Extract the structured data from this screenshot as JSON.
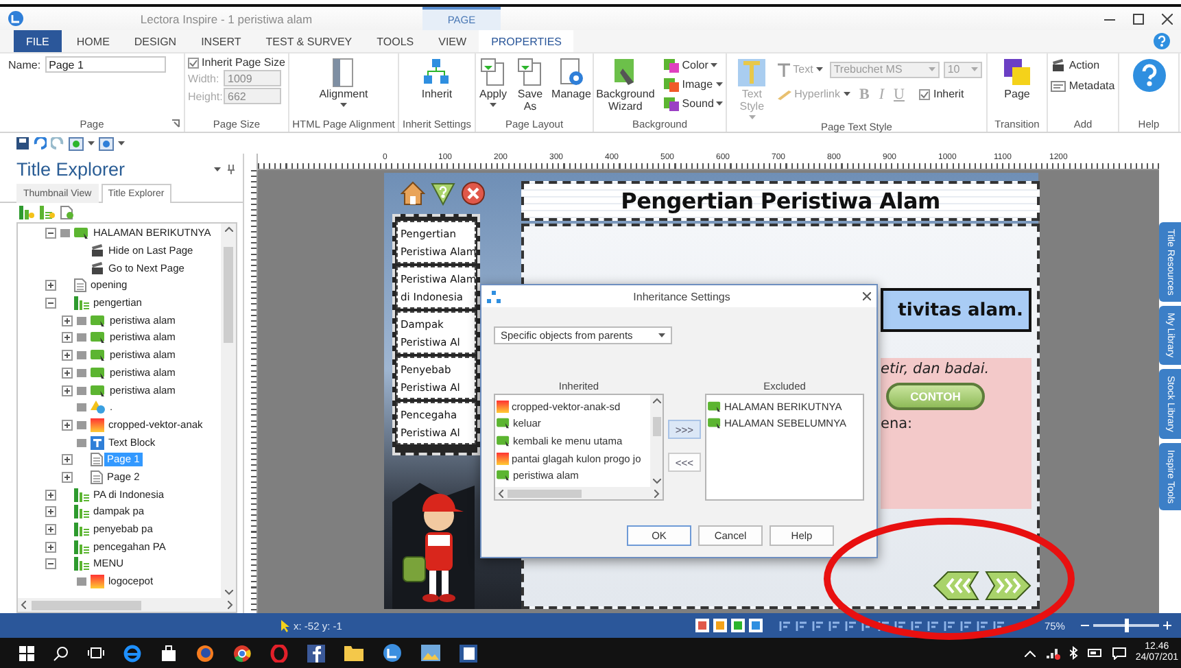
{
  "window": {
    "title": "Lectora Inspire - 1 peristiwa alam",
    "context_tab": "PAGE"
  },
  "menu_tabs": [
    {
      "label": "FILE",
      "kind": "file",
      "selected": false
    },
    {
      "label": "HOME",
      "kind": "tab",
      "selected": false
    },
    {
      "label": "DESIGN",
      "kind": "tab",
      "selected": false
    },
    {
      "label": "INSERT",
      "kind": "tab",
      "selected": false
    },
    {
      "label": "TEST & SURVEY",
      "kind": "tab",
      "selected": false
    },
    {
      "label": "TOOLS",
      "kind": "tab",
      "selected": false
    },
    {
      "label": "VIEW",
      "kind": "tab",
      "selected": false
    },
    {
      "label": "PROPERTIES",
      "kind": "tab",
      "selected": true
    }
  ],
  "ribbon": {
    "page": {
      "caption": "Page",
      "name_label": "Name:",
      "name_value": "Page 1"
    },
    "page_size": {
      "caption": "Page Size",
      "inherit_label": "Inherit Page Size",
      "inherit_checked": true,
      "width_label": "Width:",
      "width_value": "1009",
      "height_label": "Height:",
      "height_value": "662",
      "fields_disabled": true
    },
    "alignment": {
      "caption": "HTML Page Alignment",
      "button": {
        "label": "Alignment",
        "dropdown": true
      }
    },
    "inherit": {
      "caption": "Inherit Settings",
      "button": {
        "label": "Inherit",
        "dropdown": false
      }
    },
    "page_layout": {
      "caption": "Page Layout",
      "buttons": [
        {
          "label": "Apply",
          "dropdown": true
        },
        {
          "label": "Save As",
          "dropdown": false
        },
        {
          "label": "Manage",
          "dropdown": false
        }
      ]
    },
    "background": {
      "caption": "Background",
      "wizard": {
        "label": "Background Wizard",
        "dropdown": false
      },
      "buttons": [
        {
          "label": "Color",
          "dropdown": true
        },
        {
          "label": "Image",
          "dropdown": true
        },
        {
          "label": "Sound",
          "dropdown": true
        }
      ]
    },
    "text_style": {
      "caption": "Page Text Style",
      "style_button": {
        "label": "Text Style",
        "dropdown": true,
        "disabled": true
      },
      "text_button": {
        "label": "Text",
        "dropdown": true,
        "disabled": true
      },
      "font": {
        "value": "Trebuchet MS",
        "disabled": true
      },
      "size": {
        "value": "10",
        "disabled": true
      },
      "hyperlink": {
        "label": "Hyperlink",
        "dropdown": true,
        "disabled": true
      },
      "format": [
        {
          "label": "B",
          "disabled": true
        },
        {
          "label": "I",
          "disabled": true
        },
        {
          "label": "U",
          "disabled": true
        }
      ],
      "inherit": {
        "label": "Inherit",
        "checked": true
      }
    },
    "transition": {
      "caption": "Transition",
      "button": {
        "label": "Page",
        "dropdown": false
      }
    },
    "add": {
      "caption": "Add",
      "buttons": [
        {
          "label": "Action"
        },
        {
          "label": "Metadata"
        }
      ]
    },
    "help": {
      "caption": "Help"
    }
  },
  "title_explorer": {
    "title": "Title Explorer",
    "tabs": [
      {
        "label": "Thumbnail View",
        "selected": false
      },
      {
        "label": "Title Explorer",
        "selected": true
      }
    ],
    "tree": [
      {
        "label": "HALAMAN BERIKUTNYA",
        "kind": "button",
        "expanded": true,
        "selected": false,
        "children": [
          {
            "label": "Hide on Last Page",
            "kind": "action",
            "selected": false
          },
          {
            "label": "Go to Next Page",
            "kind": "action",
            "selected": false
          }
        ]
      },
      {
        "label": "opening",
        "kind": "page",
        "expanded": false,
        "selected": false
      },
      {
        "label": "pengertian",
        "kind": "chapter",
        "expanded": true,
        "selected": false,
        "children": [
          {
            "label": "peristiwa alam",
            "kind": "button",
            "expanded": false,
            "selected": false
          },
          {
            "label": "peristiwa alam",
            "kind": "button",
            "expanded": false,
            "selected": false
          },
          {
            "label": "peristiwa alam",
            "kind": "button",
            "expanded": false,
            "selected": false
          },
          {
            "label": "peristiwa alam",
            "kind": "button",
            "expanded": false,
            "selected": false
          },
          {
            "label": "peristiwa alam",
            "kind": "button",
            "expanded": false,
            "selected": false
          },
          {
            "label": ".",
            "kind": "shape",
            "selected": false
          },
          {
            "label": "cropped-vektor-anak",
            "kind": "image",
            "expanded": false,
            "selected": false
          },
          {
            "label": "Text Block",
            "kind": "text",
            "selected": false
          },
          {
            "label": "Page 1",
            "kind": "page",
            "expanded": false,
            "selected": true
          },
          {
            "label": "Page 2",
            "kind": "page",
            "expanded": false,
            "selected": false
          }
        ]
      },
      {
        "label": "PA di Indonesia",
        "kind": "chapter",
        "expanded": false,
        "selected": false
      },
      {
        "label": "dampak pa",
        "kind": "chapter",
        "expanded": false,
        "selected": false
      },
      {
        "label": "penyebab pa",
        "kind": "chapter",
        "expanded": false,
        "selected": false
      },
      {
        "label": "pencegahan PA",
        "kind": "chapter",
        "expanded": false,
        "selected": false
      },
      {
        "label": "MENU",
        "kind": "chapter",
        "expanded": true,
        "selected": false,
        "children": [
          {
            "label": "logocepot",
            "kind": "image",
            "selected": false
          }
        ]
      }
    ]
  },
  "ruler": {
    "labels": [
      "0",
      "100",
      "200",
      "300",
      "400",
      "500",
      "600",
      "700",
      "800",
      "900",
      "1000",
      "1100",
      "1200"
    ]
  },
  "page": {
    "title": "Pengertian Peristiwa Alam",
    "menu": [
      {
        "lines": [
          "Pengertian",
          "Peristiwa Alam"
        ]
      },
      {
        "lines": [
          "Peristiwa Alam",
          "di Indonesia"
        ]
      },
      {
        "lines": [
          "Dampak",
          "Peristiwa Al"
        ]
      },
      {
        "lines": [
          "Penyebab",
          "Peristiwa Al"
        ]
      },
      {
        "lines": [
          "Pencegaha",
          "Peristiwa Al"
        ]
      }
    ],
    "content": {
      "box_text": "tivitas alam.",
      "italic_text": "etir, dan badai.",
      "button": "CONTOH",
      "text": "ena:"
    }
  },
  "dialog": {
    "title": "Inheritance Settings",
    "mode": "Specific objects from parents",
    "inherited_label": "Inherited",
    "excluded_label": "Excluded",
    "inherited": [
      {
        "label": "cropped-vektor-anak-sd",
        "kind": "image"
      },
      {
        "label": "keluar",
        "kind": "button"
      },
      {
        "label": "kembali ke menu utama",
        "kind": "button"
      },
      {
        "label": "pantai glagah kulon progo jo",
        "kind": "image"
      },
      {
        "label": "peristiwa alam",
        "kind": "button"
      }
    ],
    "excluded": [
      {
        "label": "HALAMAN BERIKUTNYA",
        "kind": "button"
      },
      {
        "label": "HALAMAN SEBELUMNYA",
        "kind": "button"
      }
    ],
    "move_right": ">>>",
    "move_left": "<<<",
    "buttons": [
      "OK",
      "Cancel",
      "Help"
    ]
  },
  "side_tabs": [
    "Title Resources",
    "My Library",
    "Stock Library",
    "Inspire Tools"
  ],
  "status_bar": {
    "coords": "x: -52 y: -1",
    "zoom": "75%",
    "zoom_slider": {
      "level": 0.5
    }
  },
  "taskbar": {
    "time": "12.46",
    "date": "24/07/201"
  }
}
